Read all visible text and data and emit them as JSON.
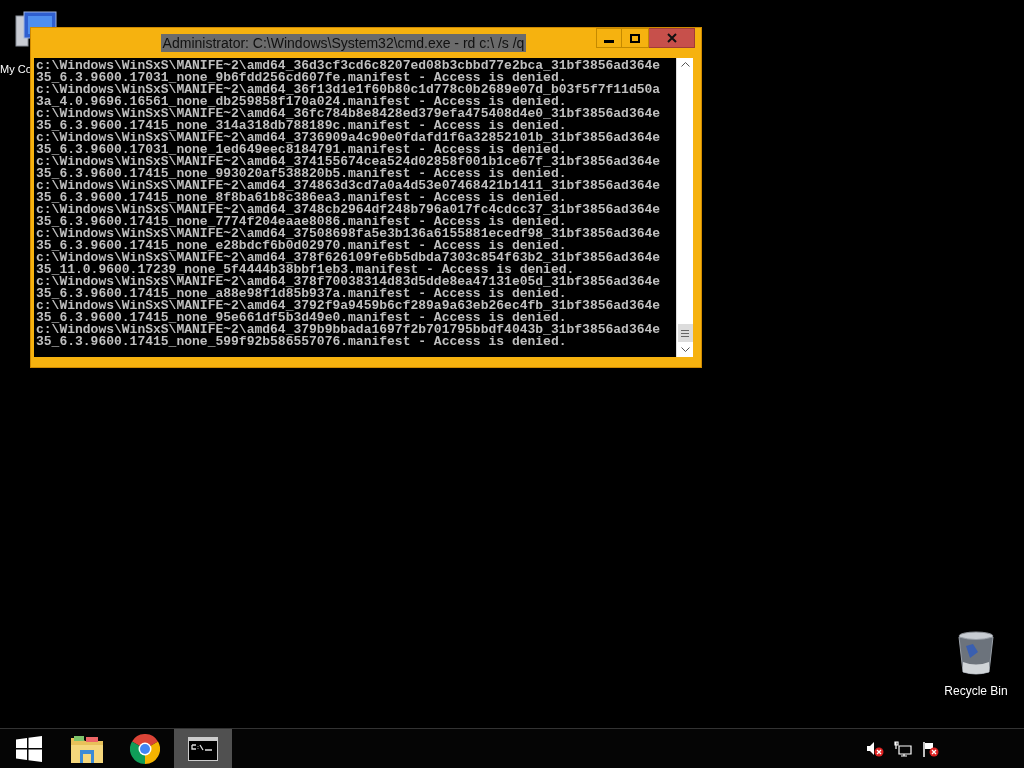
{
  "desktop_icons": [
    {
      "kind": "computer",
      "label": "My Co"
    },
    {
      "kind": "recycle",
      "label": "Recycle Bin"
    }
  ],
  "window": {
    "title": "Administrator: C:\\Windows\\System32\\cmd.exe - rd  c:\\ /s /q",
    "console_lines": [
      "c:\\Windows\\WinSxS\\MANIFE~2\\amd64_36d3cf3cd6c8207ed08b3cbbd77e2bca_31bf3856ad364e",
      "35_6.3.9600.17031_none_9b6fdd256cd607fe.manifest - Access is denied.",
      "c:\\Windows\\WinSxS\\MANIFE~2\\amd64_36f13d1e1f60b80c1d778c0b2689e07d_b03f5f7f11d50a",
      "3a_4.0.9696.16561_none_db259858f170a024.manifest - Access is denied.",
      "c:\\Windows\\WinSxS\\MANIFE~2\\amd64_36fc784b8e8428ed379efa475408d4e0_31bf3856ad364e",
      "35_6.3.9600.17415_none_314a318db788189c.manifest - Access is denied.",
      "c:\\Windows\\WinSxS\\MANIFE~2\\amd64_3736909a4c90e0fdafd1f6a32852101b_31bf3856ad364e",
      "35_6.3.9600.17031_none_1ed649eec8184791.manifest - Access is denied.",
      "c:\\Windows\\WinSxS\\MANIFE~2\\amd64_374155674cea524d02858f001b1ce67f_31bf3856ad364e",
      "35_6.3.9600.17415_none_993020af538820b5.manifest - Access is denied.",
      "c:\\Windows\\WinSxS\\MANIFE~2\\amd64_374863d3cd7a0a4d53e07468421b1411_31bf3856ad364e",
      "35_6.3.9600.17415_none_8f8ba61b8c386ea3.manifest - Access is denied.",
      "c:\\Windows\\WinSxS\\MANIFE~2\\amd64_3748cb2964df248b796a017fc4cdcc37_31bf3856ad364e",
      "35_6.3.9600.17415_none_7774f204eaae8086.manifest - Access is denied.",
      "c:\\Windows\\WinSxS\\MANIFE~2\\amd64_37508698fa5e3b136a6155881ecedf98_31bf3856ad364e",
      "35_6.3.9600.17415_none_e28bdcf6b0d02970.manifest - Access is denied.",
      "c:\\Windows\\WinSxS\\MANIFE~2\\amd64_378f626109fe6b5dbda7303c854f63b2_31bf3856ad364e",
      "35_11.0.9600.17239_none_5f4444b38bbf1eb3.manifest - Access is denied.",
      "c:\\Windows\\WinSxS\\MANIFE~2\\amd64_378f70038314d83d5dde8ea47131e05d_31bf3856ad364e",
      "35_6.3.9600.17415_none_a88e98f1d85b937a.manifest - Access is denied.",
      "c:\\Windows\\WinSxS\\MANIFE~2\\amd64_3792f9a9459b6cf289a9a63eb26ec4fb_31bf3856ad364e",
      "35_6.3.9600.17415_none_95e661df5b3d49e0.manifest - Access is denied.",
      "c:\\Windows\\WinSxS\\MANIFE~2\\amd64_379b9bbada1697f2b701795bbdf4043b_31bf3856ad364e",
      "35_6.3.9600.17415_none_599f92b586557076.manifest - Access is denied."
    ]
  },
  "taskbar": {
    "items": [
      {
        "kind": "start",
        "selected": false
      },
      {
        "kind": "explorer",
        "selected": false
      },
      {
        "kind": "chrome",
        "selected": false
      },
      {
        "kind": "cmd",
        "selected": true
      }
    ]
  }
}
